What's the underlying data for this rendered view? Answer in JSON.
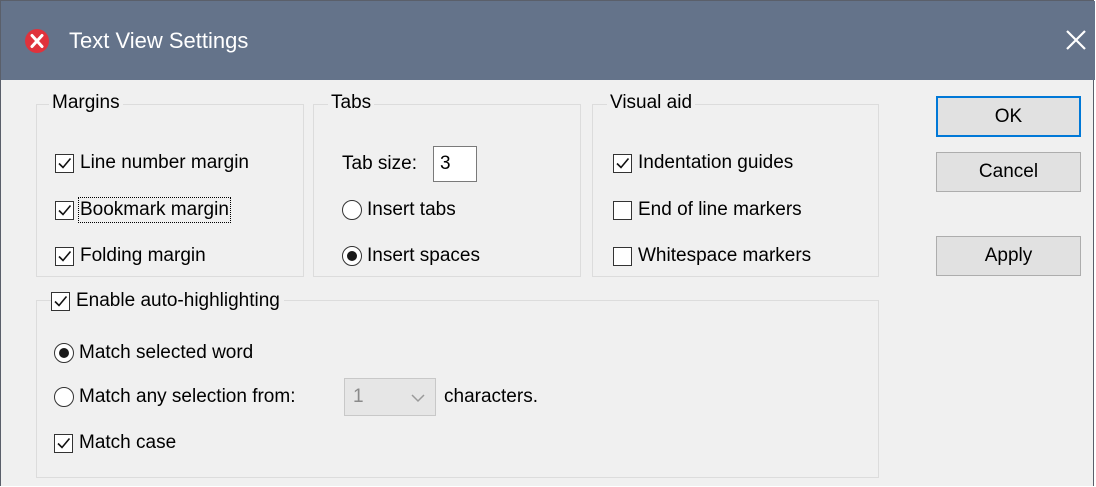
{
  "window": {
    "title": "Text View Settings",
    "app_icon": "altova-x-icon",
    "close_icon": "close-icon"
  },
  "margins": {
    "label": "Margins",
    "items": [
      {
        "label": "Line number margin",
        "checked": true
      },
      {
        "label": "Bookmark margin",
        "checked": true
      },
      {
        "label": "Folding margin",
        "checked": true
      }
    ]
  },
  "tabs": {
    "label": "Tabs",
    "tab_size_label": "Tab size:",
    "tab_size_value": "3",
    "options": [
      {
        "label": "Insert tabs",
        "selected": false
      },
      {
        "label": "Insert spaces",
        "selected": true
      }
    ]
  },
  "visual_aid": {
    "label": "Visual aid",
    "items": [
      {
        "label": "Indentation guides",
        "checked": true
      },
      {
        "label": "End of line markers",
        "checked": false
      },
      {
        "label": "Whitespace markers",
        "checked": false
      }
    ]
  },
  "auto_highlight": {
    "label": "Enable auto-highlighting",
    "checked": true,
    "match_selected_word": "Match selected word",
    "match_any_selection": "Match any selection from:",
    "chars_value": "1",
    "chars_suffix": "characters.",
    "match_case": "Match case",
    "match_case_checked": true,
    "selected_mode": "Match selected word"
  },
  "buttons": {
    "ok": "OK",
    "cancel": "Cancel",
    "apply": "Apply"
  },
  "colors": {
    "titlebar": "#64738a",
    "dialog_bg": "#f0f0f0",
    "default_button_border": "#0078d7",
    "app_icon": "#e0323c"
  }
}
